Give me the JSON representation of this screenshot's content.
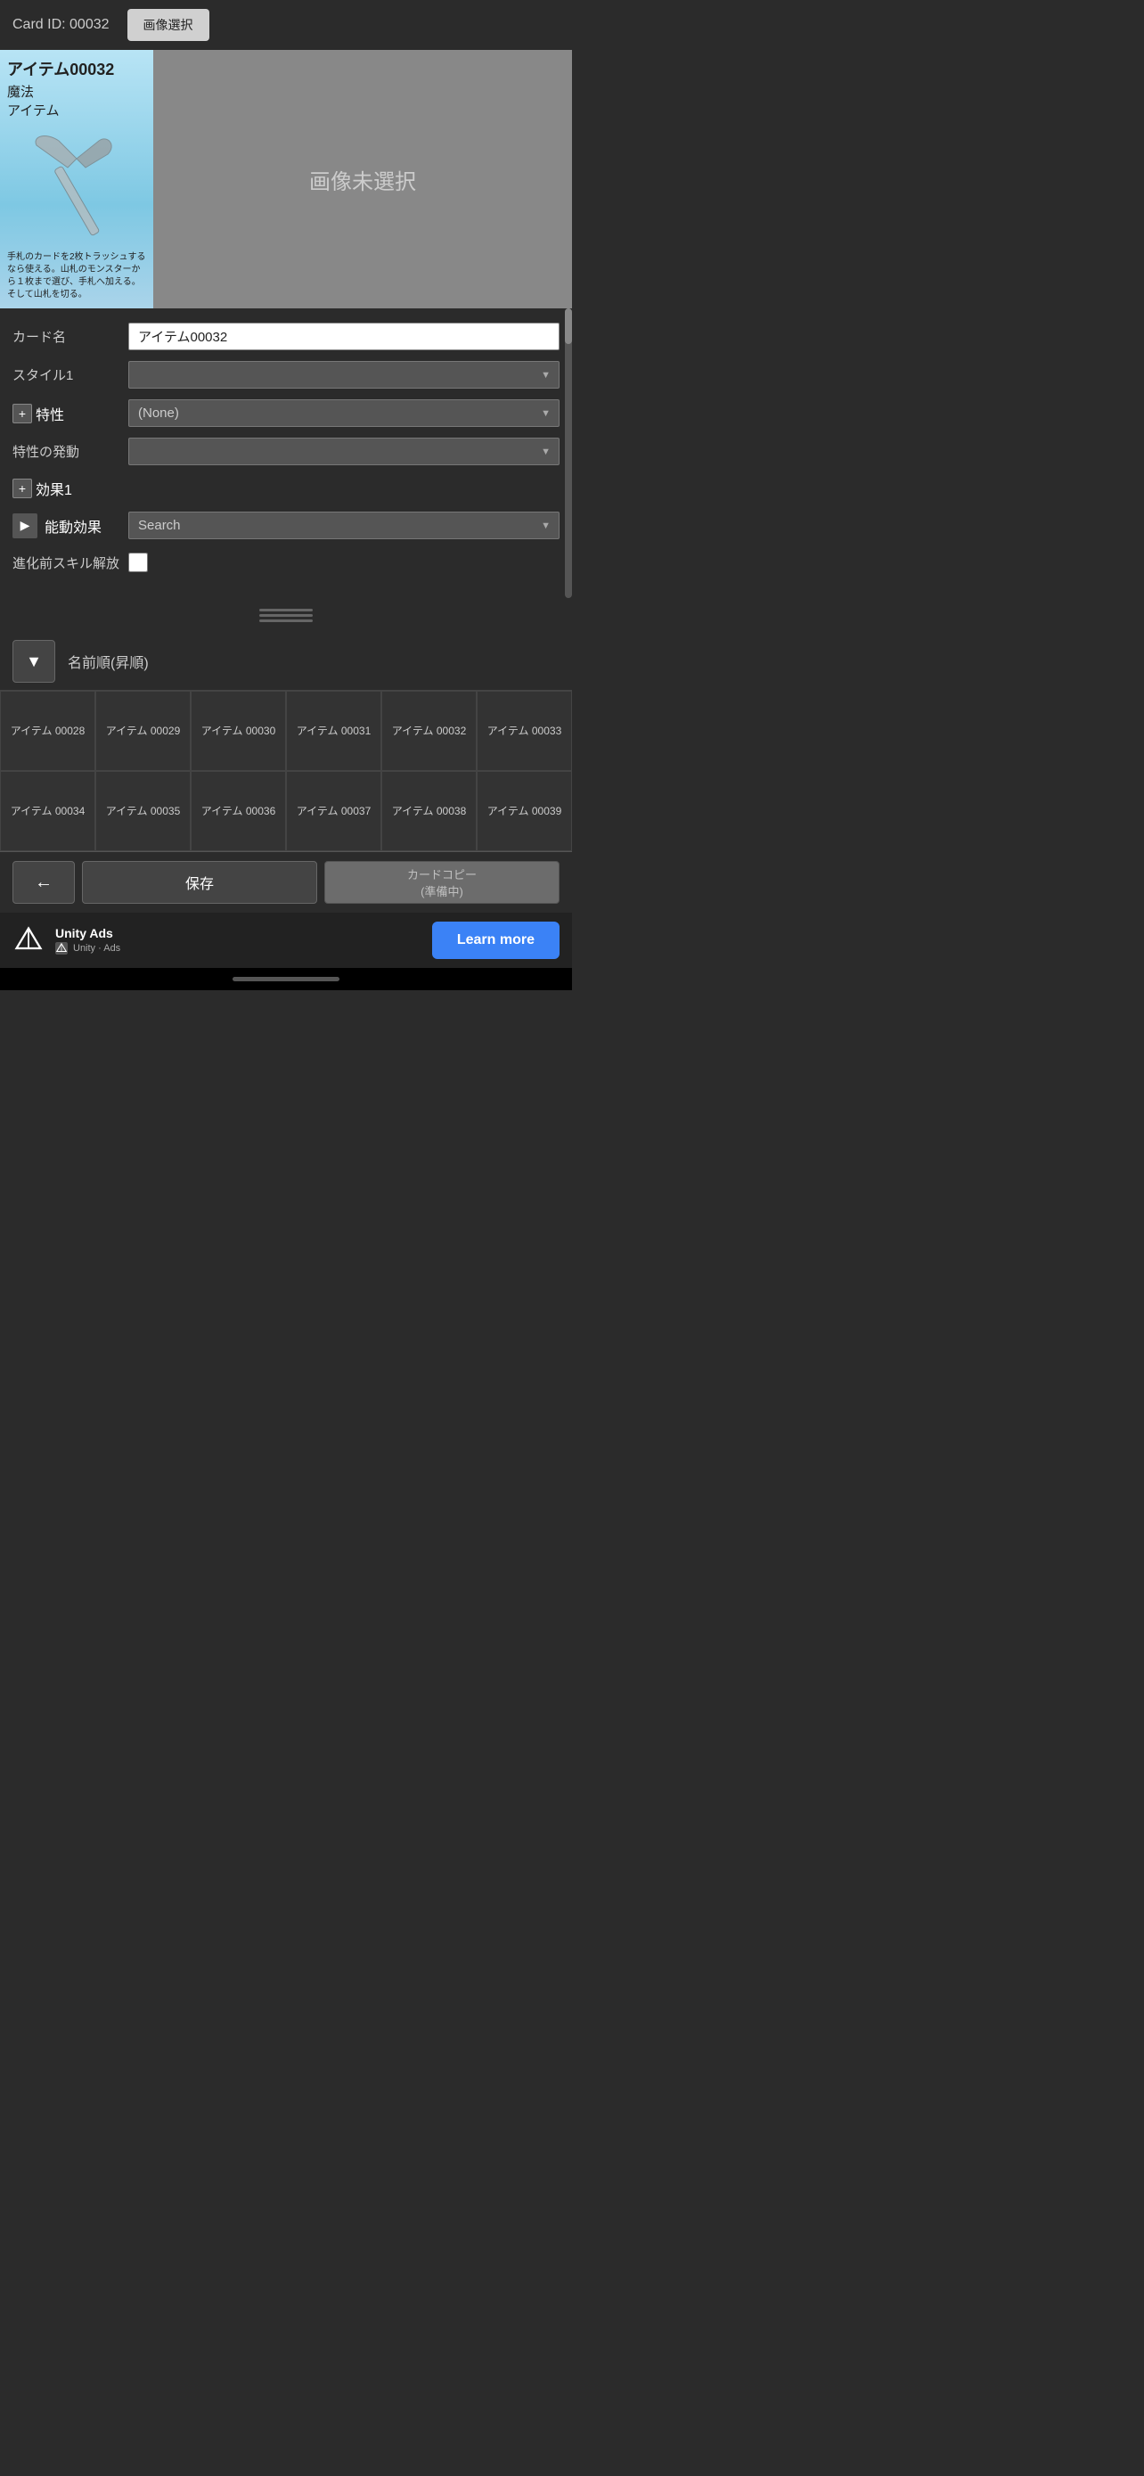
{
  "header": {
    "card_id_label": "Card ID: 00032",
    "image_select_btn": "画像選択"
  },
  "card_preview": {
    "title": "アイテム00032",
    "type1": "魔法",
    "type2": "アイテム",
    "description": "手札のカードを2枚トラッシュするなら使える。山札のモンスターから１枚まで選び、手札へ加える。そして山札を切る。",
    "image_placeholder": "画像未選択"
  },
  "form": {
    "card_name_label": "カード名",
    "card_name_value": "アイテム00032",
    "style1_label": "スタイル1",
    "style1_value": "",
    "trait_label": "特性",
    "trait_value": "(None)",
    "trait_trigger_label": "特性の発動",
    "trait_trigger_value": "",
    "effect1_label": "効果1",
    "active_effect_label": "能動効果",
    "active_effect_value": "Search",
    "pre_evo_label": "進化前スキル解放"
  },
  "sort": {
    "sort_label": "名前順(昇順)",
    "sort_btn": "▼"
  },
  "grid_cards": [
    {
      "label": "アイテム\n00028"
    },
    {
      "label": "アイテム\n00029"
    },
    {
      "label": "アイテム\n00030"
    },
    {
      "label": "アイテム\n00031"
    },
    {
      "label": "アイテム\n00032"
    },
    {
      "label": "アイテム\n00033"
    },
    {
      "label": "アイテム\n00034"
    },
    {
      "label": "アイテム\n00035"
    },
    {
      "label": "アイテム\n00036"
    },
    {
      "label": "アイテム\n00037"
    },
    {
      "label": "アイテム\n00038"
    },
    {
      "label": "アイテム\n00039"
    }
  ],
  "actions": {
    "back_btn": "←",
    "save_btn": "保存",
    "copy_btn": "カードコピー\n(準備中)"
  },
  "ad": {
    "brand": "Unity Ads",
    "sub_label": "Unity · Ads",
    "learn_more": "Learn more"
  },
  "home_indicator": {}
}
